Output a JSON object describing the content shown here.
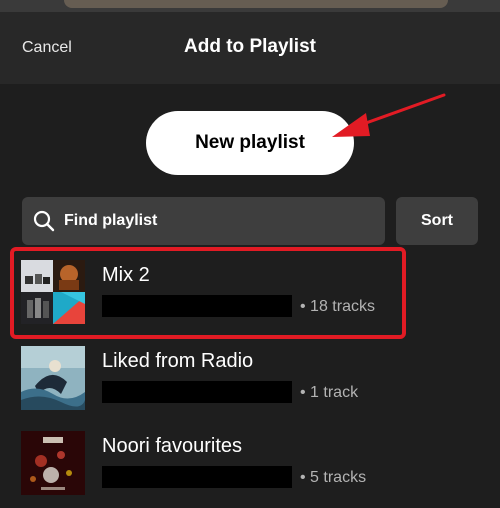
{
  "header": {
    "cancel_label": "Cancel",
    "title": "Add to Playlist"
  },
  "actions": {
    "new_playlist_label": "New playlist",
    "sort_label": "Sort"
  },
  "search": {
    "placeholder": "Find playlist"
  },
  "playlists": [
    {
      "title": "Mix 2",
      "track_count": "• 18 tracks",
      "selected": true
    },
    {
      "title": "Liked from Radio",
      "track_count": "• 1 track",
      "selected": false
    },
    {
      "title": "Noori favourites",
      "track_count": "• 5 tracks",
      "selected": false
    }
  ],
  "colors": {
    "highlight": "#e21b24",
    "arrow": "#e21b24",
    "background": "#121212"
  }
}
